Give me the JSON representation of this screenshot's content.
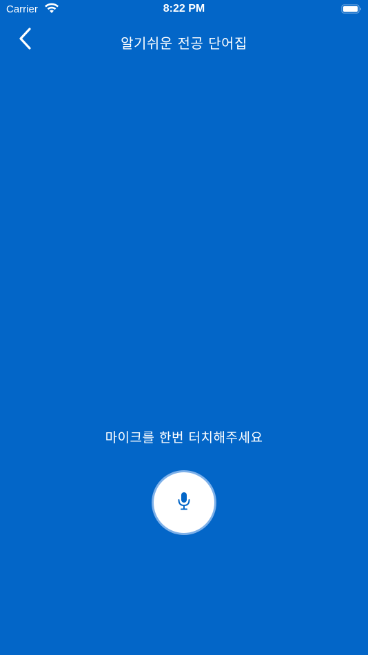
{
  "status_bar": {
    "carrier": "Carrier",
    "time": "8:22 PM",
    "wifi_icon": "wifi-icon",
    "battery_icon": "battery-icon"
  },
  "nav": {
    "back_icon": "chevron-left-icon",
    "title": "알기쉬운 전공 단어집"
  },
  "main": {
    "prompt": "마이크를 한번 터치해주세요",
    "mic_icon": "microphone-icon"
  },
  "colors": {
    "background": "#0366c8",
    "mic_button_bg": "#ffffff",
    "mic_button_ring": "#7db0e9",
    "mic_icon": "#0366c8"
  }
}
